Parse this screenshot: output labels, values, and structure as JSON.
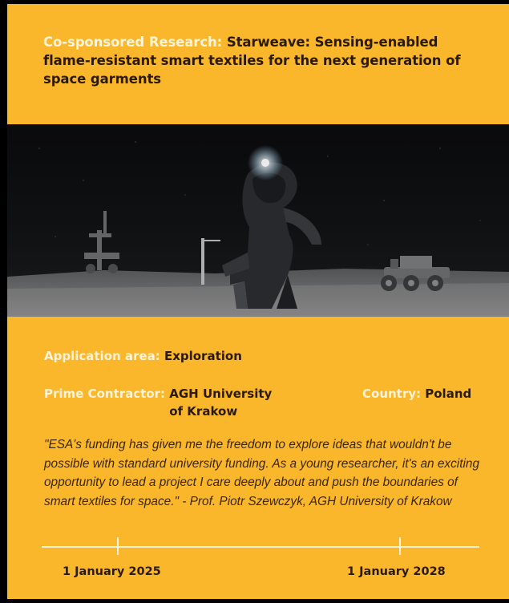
{
  "title": {
    "label": "Co-sponsored Research:",
    "text": "Starweave: Sensing-enabled flame-resistant smart textiles for the next generation of space garments"
  },
  "image": {
    "subject": "astronaut-on-lunar-surface-with-rovers"
  },
  "application": {
    "label": "Application area:",
    "value": "Exploration"
  },
  "prime": {
    "label": "Prime Contractor:",
    "value": "AGH University of Krakow"
  },
  "country": {
    "label": "Country:",
    "value": "Poland"
  },
  "quote": "\"ESA's funding has given me the freedom to explore ideas that wouldn't be possible with standard university funding. As a young researcher, it's an exciting opportunity to lead a project I care deeply about and push the boundaries of smart textiles for space.\" - Prof. Piotr Szewczyk, AGH University of Krakow",
  "timeline": {
    "start": "1 January 2025",
    "end": "1 January 2028"
  },
  "colors": {
    "background": "#000000",
    "card": "#fbb72b",
    "label": "#fff3da",
    "text": "#2a1a00"
  }
}
